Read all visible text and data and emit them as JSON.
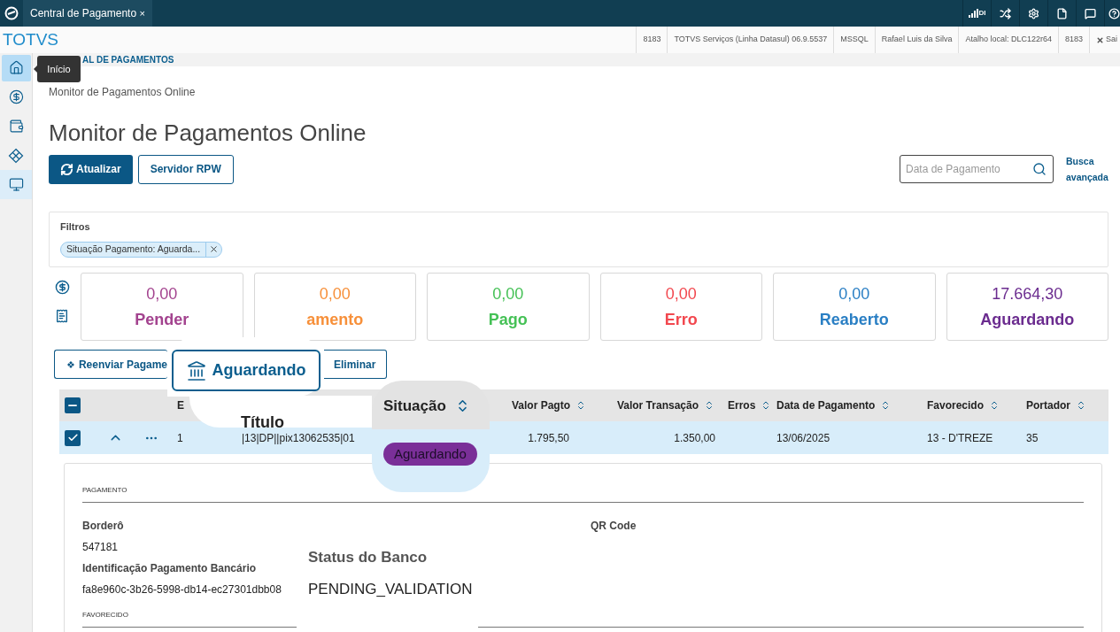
{
  "topbar": {
    "tab": {
      "label": "Central de Pagamento",
      "close": "×"
    },
    "signal_label": "DI",
    "icons": [
      {
        "kind": "shuffle"
      },
      {
        "kind": "settings"
      },
      {
        "kind": "file"
      },
      {
        "kind": "chat"
      },
      {
        "kind": "help"
      }
    ]
  },
  "infobar": {
    "brand": "TOTVS",
    "cells": [
      "8183",
      "TOTVS Serviços (Linha Datasul) 06.9.5537",
      "MSSQL",
      "Rafael Luis da Silva",
      "Atalho local: DLC122r64",
      "8183"
    ],
    "exit": "Sai"
  },
  "sidebar": {
    "items": [
      {
        "kind": "home",
        "selected": false,
        "hovered": true
      },
      {
        "kind": "dollar",
        "selected": false,
        "hovered": false
      },
      {
        "kind": "wallet",
        "selected": false,
        "hovered": false
      },
      {
        "kind": "diamond",
        "selected": false,
        "hovered": false
      },
      {
        "kind": "monitor",
        "selected": true,
        "hovered": false
      }
    ],
    "tooltip": "Início"
  },
  "header": {
    "title": "AL DE PAGAMENTOS"
  },
  "breadcrumb": "Monitor de Pagamentos Online",
  "page_title": "Monitor de Pagamentos Online",
  "buttons": [
    {
      "label": "Atualizar",
      "kind": "primary"
    },
    {
      "label": "Servidor RPW",
      "kind": "secondary"
    }
  ],
  "search": {
    "placeholder": "Data de Pagamento"
  },
  "advanced_search": "Busca avançada",
  "filters": {
    "title": "Filtros",
    "chips": [
      "Situação Pagamento: Aguarda..."
    ]
  },
  "cards": [
    {
      "value": "0,00",
      "label": "Pender",
      "color": "#a3438f"
    },
    {
      "value": "0,00",
      "label": "amento",
      "color": "#f7903a"
    },
    {
      "value": "0,00",
      "label": "Pago",
      "color": "#45c156"
    },
    {
      "value": "0,00",
      "label": "Erro",
      "color": "#f2484f"
    },
    {
      "value": "0,00",
      "label": "Reaberto",
      "color": "#2a7fc4"
    },
    {
      "value": "17.664,30",
      "label": "Aguardando",
      "color": "#6b2c8f"
    }
  ],
  "actions": [
    "Reenviar Pagame",
    "Eliminar"
  ],
  "table": {
    "select_all": {
      "indeterminate": true
    },
    "columns": [
      {
        "label": "E",
        "sortable": false
      },
      {
        "label": "Valor Pagto",
        "sortable": true
      },
      {
        "label": "Valor Transação",
        "sortable": true
      },
      {
        "label": "Erros",
        "sortable": true
      },
      {
        "label": "Data de Pagamento",
        "sortable": true
      },
      {
        "label": "Favorecido",
        "sortable": true
      },
      {
        "label": "Portador",
        "sortable": true
      }
    ],
    "rows": [
      {
        "selected": true,
        "expanded": true,
        "number": "1",
        "title": "|13|DP||pix13062535|01",
        "valor_pagto": "1.795,50",
        "valor_transacao": "1.350,00",
        "data_pagamento": "13/06/2025",
        "favorecido": "13 - D'TREZE",
        "portador": "35"
      }
    ]
  },
  "detail": {
    "sections": [
      {
        "title": "PAGAMENTO"
      },
      {
        "title": "FAVORECIDO"
      }
    ],
    "fields": [
      {
        "label": "Borderô",
        "value": "547181"
      },
      {
        "label": "Identificação Pagamento Bancário",
        "value": "fa8e960c-3b26-5998-db14-ec27301dbb08"
      }
    ],
    "qr_label": "QR Code"
  },
  "callouts": {
    "button": "Aguardando",
    "column_title": "Título",
    "column_status": "Situação",
    "status_pill": "Aguardando",
    "bank_status_label": "Status do Banco",
    "bank_status_value": "PENDING_VALIDATION"
  }
}
